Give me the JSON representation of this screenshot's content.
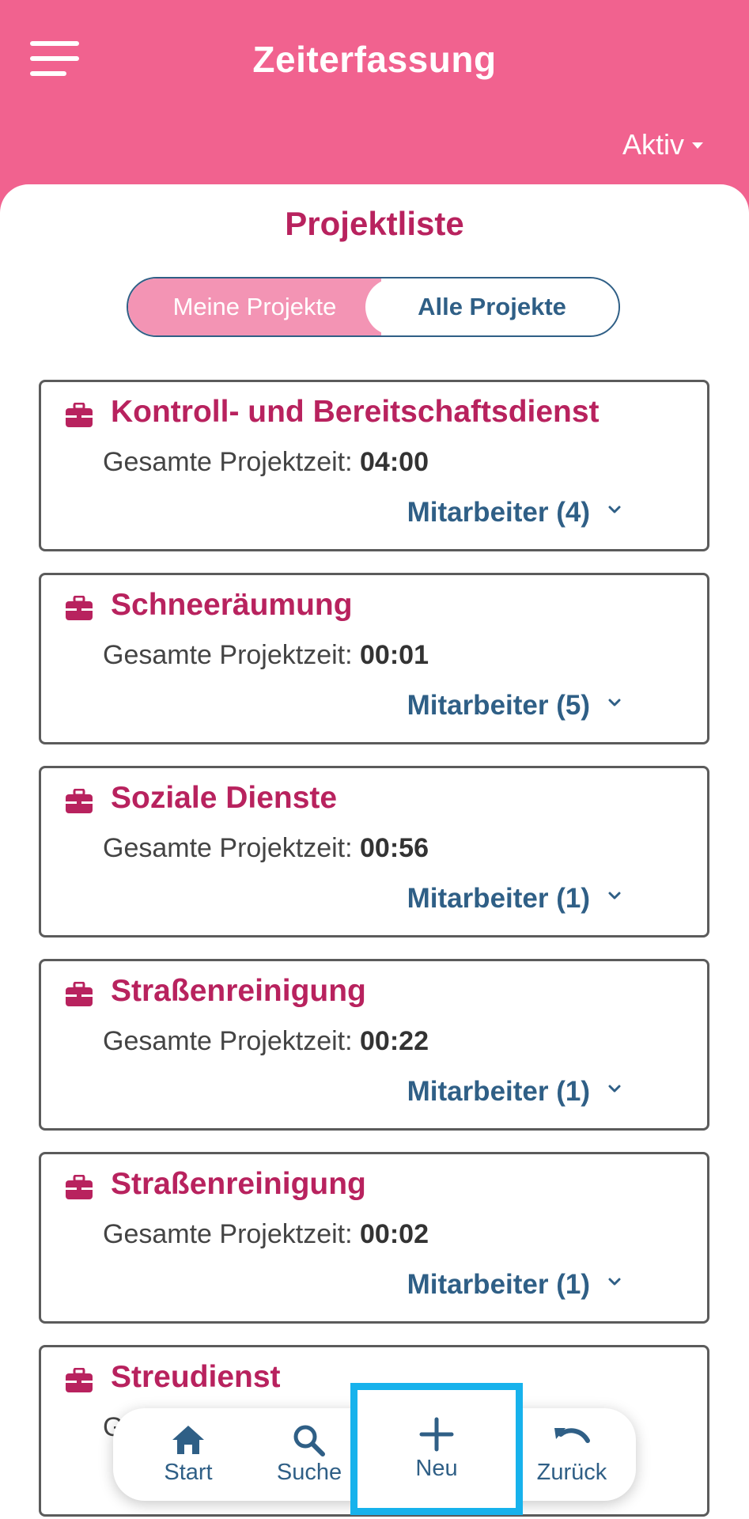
{
  "header": {
    "title": "Zeiterfassung",
    "menu_icon": "hamburger-icon",
    "status_filter": "Aktiv"
  },
  "main": {
    "title": "Projektliste",
    "tabs": [
      {
        "label": "Meine Projekte",
        "active": true
      },
      {
        "label": "Alle Projekte",
        "active": false
      }
    ]
  },
  "projects": [
    {
      "name": "Kontroll- und Bereitschaftsdienst",
      "time_label": "Gesamte Projektzeit:",
      "time": "04:00",
      "members": "Mitarbeiter (4)"
    },
    {
      "name": "Schneeräumung",
      "time_label": "Gesamte Projektzeit:",
      "time": "00:01",
      "members": "Mitarbeiter (5)"
    },
    {
      "name": "Soziale Dienste",
      "time_label": "Gesamte Projektzeit:",
      "time": "00:56",
      "members": "Mitarbeiter (1)"
    },
    {
      "name": "Straßenreinigung",
      "time_label": "Gesamte Projektzeit:",
      "time": "00:22",
      "members": "Mitarbeiter (1)"
    },
    {
      "name": "Straßenreinigung",
      "time_label": "Gesamte Projektzeit:",
      "time": "00:02",
      "members": "Mitarbeiter (1)"
    },
    {
      "name": "Streudienst",
      "time_label": "G",
      "time": "",
      "members": ""
    }
  ],
  "bottom_nav": {
    "start": "Start",
    "search": "Suche",
    "new": "Neu",
    "back": "Zurück"
  },
  "colors": {
    "header": "#f1628f",
    "accent": "#b8225e",
    "link": "#2f5f86",
    "highlight": "#17b2ec"
  }
}
